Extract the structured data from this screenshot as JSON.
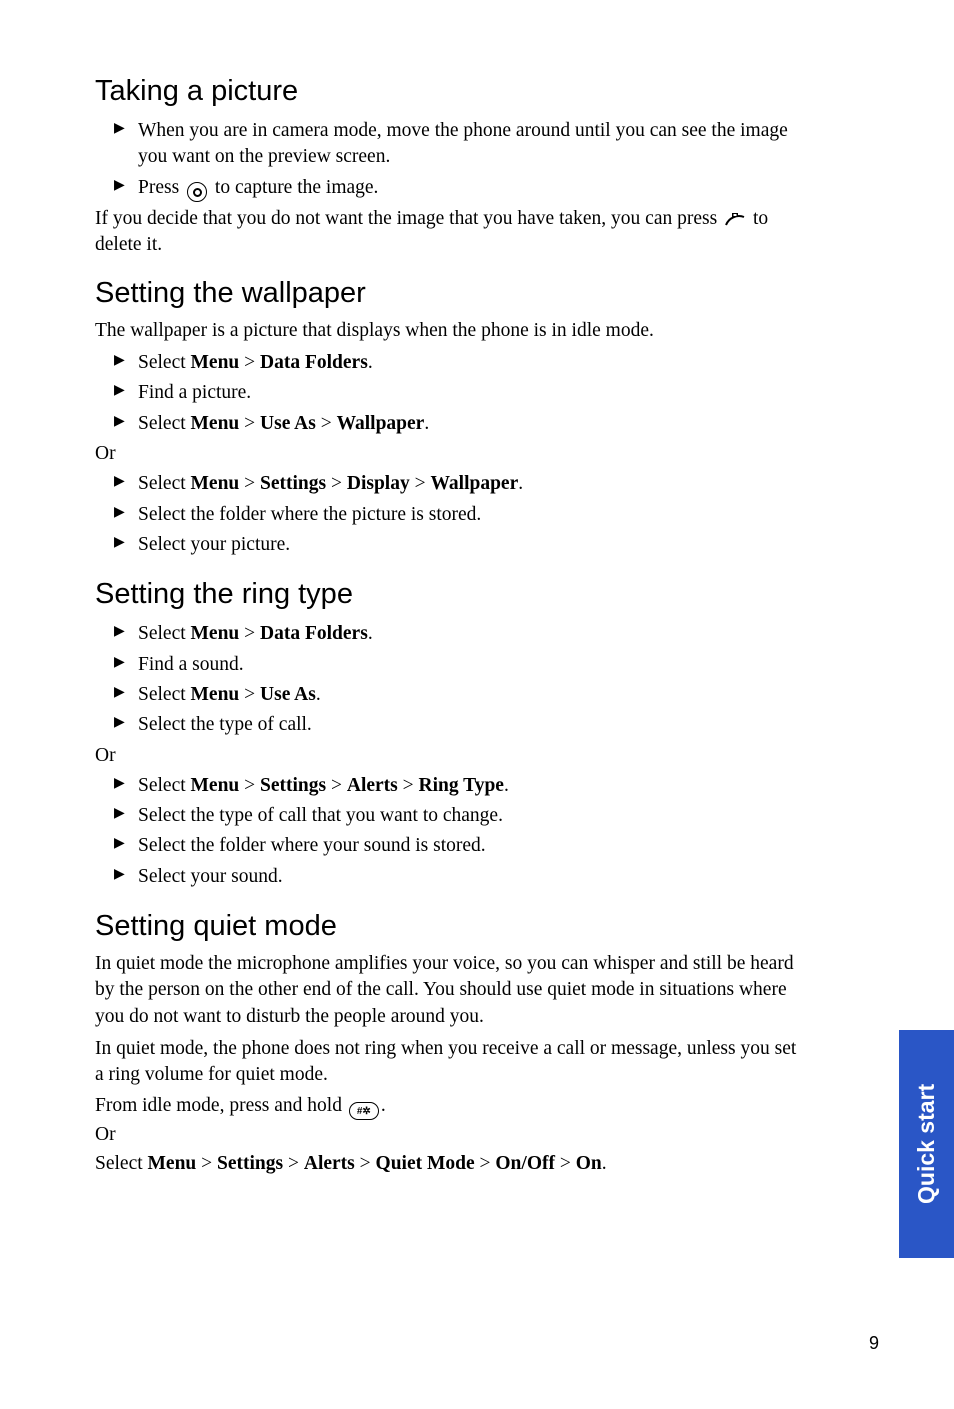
{
  "sections": {
    "taking_picture": {
      "heading": "Taking a picture",
      "step1": "When you are in camera mode, move the phone around until you can see the image you want on the preview screen.",
      "step2_pre": "Press ",
      "step2_post": "  to capture the image.",
      "note_pre": "If you decide that you do not want the image that you have taken, you can press ",
      "note_post": " to delete it."
    },
    "wallpaper": {
      "heading": "Setting the wallpaper",
      "intro": "The wallpaper is a picture that displays when the phone is in idle mode.",
      "a1_pre": "Select ",
      "a1_m1": "Menu",
      "a1_gt1": " > ",
      "a1_m2": "Data Folders",
      "a1_post": ".",
      "a2": "Find a picture.",
      "a3_pre": "Select ",
      "a3_m1": "Menu",
      "a3_gt1": " > ",
      "a3_m2": "Use As",
      "a3_gt2": " > ",
      "a3_m3": "Wallpaper",
      "a3_post": ".",
      "or": "Or",
      "b1_pre": "Select ",
      "b1_m1": "Menu",
      "b1_gt1": " > ",
      "b1_m2": "Settings",
      "b1_gt2": " > ",
      "b1_m3": "Display",
      "b1_gt3": " > ",
      "b1_m4": "Wallpaper",
      "b1_post": ".",
      "b2": "Select the folder where the picture is stored.",
      "b3": "Select your picture."
    },
    "ringtype": {
      "heading": "Setting the ring type",
      "a1_pre": "Select ",
      "a1_m1": "Menu",
      "a1_gt1": " > ",
      "a1_m2": "Data Folders",
      "a1_post": ".",
      "a2": "Find a sound.",
      "a3_pre": "Select ",
      "a3_m1": "Menu",
      "a3_gt1": " > ",
      "a3_m2": "Use As",
      "a3_post": ".",
      "a4": "Select the type of call.",
      "or": "Or",
      "b1_pre": "Select ",
      "b1_m1": "Menu",
      "b1_gt1": " > ",
      "b1_m2": "Settings",
      "b1_gt2": " > ",
      "b1_m3": "Alerts",
      "b1_gt3": " > ",
      "b1_m4": "Ring Type",
      "b1_post": ".",
      "b2": "Select the type of call that you want to change.",
      "b3": "Select the folder where your sound is stored.",
      "b4": "Select your sound."
    },
    "quiet": {
      "heading": "Setting quiet mode",
      "p1": "In quiet mode the microphone amplifies your voice, so you can whisper and still be heard by the person on the other end of the call. You should use quiet mode in situations where you do not want to disturb the people around you.",
      "p2": "In quiet mode, the phone does not ring when you receive a call or message, unless you set a ring volume for quiet mode.",
      "p3_pre": "From idle mode, press and hold ",
      "p3_post": ".",
      "or": "Or",
      "p4_pre": "Select ",
      "p4_m1": "Menu",
      "p4_gt1": " > ",
      "p4_m2": "Settings",
      "p4_gt2": " > ",
      "p4_m3": "Alerts",
      "p4_gt3": " > ",
      "p4_m4": "Quiet Mode",
      "p4_gt4": " > ",
      "p4_m5": "On/Off",
      "p4_gt5": " > ",
      "p4_m6": "On",
      "p4_post": "."
    }
  },
  "side_tab": "Quick start",
  "page_number": "9",
  "icons": {
    "capture": "capture-button-icon",
    "right_soft": "right-softkey-icon",
    "hash": "hash-key-icon",
    "hash_label": "#✲"
  }
}
